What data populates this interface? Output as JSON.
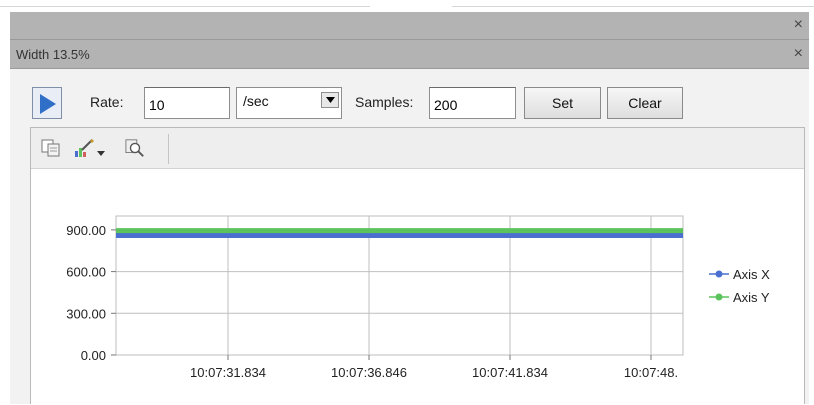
{
  "window": {
    "top_close": "×",
    "panel_title": "Width 13.5%",
    "panel_close": "×"
  },
  "controls": {
    "play_icon": "play-icon",
    "rate_label": "Rate:",
    "rate_value": "10",
    "rate_unit": "/sec",
    "samples_label": "Samples:",
    "samples_value": "200",
    "set_label": "Set",
    "clear_label": "Clear"
  },
  "toolbar": {
    "icons": [
      "copy-icon",
      "chart-edit-icon",
      "dropdown-arrow-icon",
      "zoom-icon"
    ]
  },
  "chart_data": {
    "type": "line",
    "xlabel": "",
    "ylabel": "",
    "ylim": [
      0,
      1000
    ],
    "y_ticks": [
      "0.00",
      "300.00",
      "600.00",
      "900.00"
    ],
    "x_ticks": [
      "10:07:31.834",
      "10:07:36.846",
      "10:07:41.834",
      "10:07:48."
    ],
    "grid": true,
    "legend_position": "right",
    "series": [
      {
        "name": "Axis X",
        "color": "#4a6fd0",
        "values": [
          860,
          860,
          860,
          860,
          860,
          860,
          860,
          860,
          860,
          860,
          860,
          860,
          860,
          860,
          860,
          860,
          860,
          860,
          860,
          860
        ]
      },
      {
        "name": "Axis Y",
        "color": "#5cc35c",
        "values": [
          895,
          895,
          895,
          895,
          895,
          895,
          895,
          895,
          895,
          895,
          895,
          895,
          895,
          895,
          895,
          895,
          895,
          895,
          895,
          895
        ]
      }
    ]
  }
}
